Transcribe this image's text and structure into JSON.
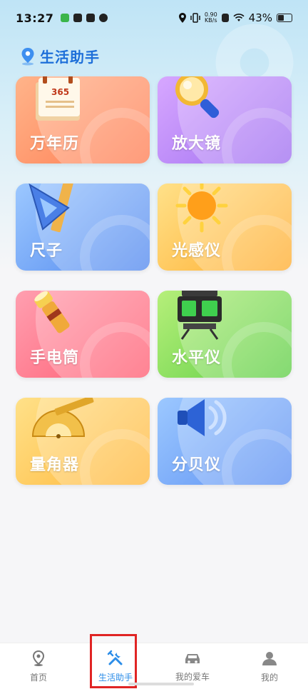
{
  "status_bar": {
    "time": "13:27",
    "speed_value": "0.90",
    "speed_unit": "KB/s",
    "battery": "43%"
  },
  "page": {
    "title": "生活助手"
  },
  "tools": [
    {
      "label": "万年历",
      "icon": "calendar-icon",
      "color": "#ff8a5c"
    },
    {
      "label": "放大镜",
      "icon": "magnifier-icon",
      "color": "#b07cf5"
    },
    {
      "label": "尺子",
      "icon": "ruler-icon",
      "color": "#5e92ef"
    },
    {
      "label": "光感仪",
      "icon": "sun-icon",
      "color": "#ffb83a"
    },
    {
      "label": "手电筒",
      "icon": "flashlight-icon",
      "color": "#ff6b7f"
    },
    {
      "label": "水平仪",
      "icon": "level-icon",
      "color": "#6ad24a"
    },
    {
      "label": "量角器",
      "icon": "protractor-icon",
      "color": "#ffbb3f"
    },
    {
      "label": "分贝仪",
      "icon": "speaker-icon",
      "color": "#5f93f2"
    }
  ],
  "bottom_nav": {
    "items": [
      {
        "label": "首页",
        "icon": "location-pin-icon"
      },
      {
        "label": "生活助手",
        "icon": "tools-icon"
      },
      {
        "label": "我的爱车",
        "icon": "car-icon"
      },
      {
        "label": "我的",
        "icon": "person-icon"
      }
    ],
    "active_index": 1
  }
}
